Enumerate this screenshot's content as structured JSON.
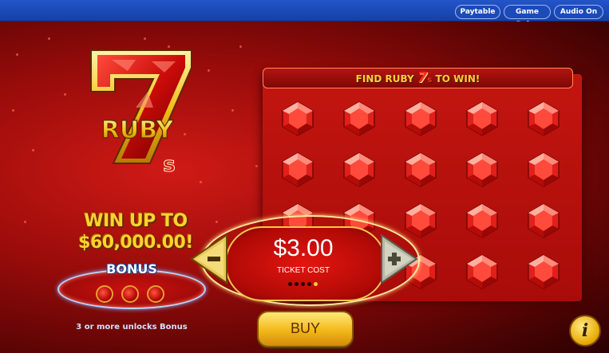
{
  "topbar": {
    "paytable_label": "Paytable",
    "game_rules_label": "Game Rules",
    "audio_label": "Audio On",
    "color": "#1a4bb8"
  },
  "logo": {
    "digit": "7",
    "word": "RUBY",
    "suffix": "s"
  },
  "promo": {
    "line1": "WIN UP TO",
    "line2": "$60,000.00!"
  },
  "bonus": {
    "label": "BONUS",
    "note": "3 or more unlocks Bonus",
    "slots": 3
  },
  "board": {
    "title_left": "FIND RUBY",
    "title_digit": "7",
    "title_suffix": "s",
    "title_right": "TO WIN!",
    "rows": 4,
    "cols": 5,
    "gem_icon": "ruby-gem-icon"
  },
  "ticket": {
    "price": "$3.00",
    "label": "TICKET COST",
    "decrease_icon": "minus-icon",
    "increase_icon": "plus-icon",
    "levels": 5,
    "selected_level": 5
  },
  "actions": {
    "buy_label": "BUY",
    "info_label": "i"
  },
  "colors": {
    "accent_gold": "#ffd22e",
    "ruby_red": "#c31510"
  }
}
